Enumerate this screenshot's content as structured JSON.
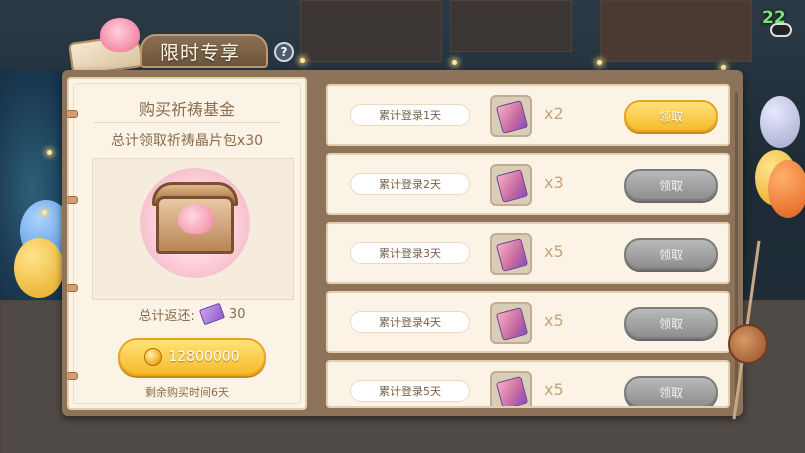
{
  "header": {
    "title": "限时专享",
    "help_label": "?",
    "top_counter": "22"
  },
  "fund": {
    "title": "购买祈祷基金",
    "subtitle": "总计领取祈祷晶片包x30",
    "total_return_label": "总计返还:",
    "total_return_value": "30",
    "price": "12800000",
    "remaining": "剩余购买时间6天"
  },
  "rewards": [
    {
      "day": "累计登录1天",
      "qty": "x2",
      "claim": "领取",
      "state": "active"
    },
    {
      "day": "累计登录2天",
      "qty": "x3",
      "claim": "领取",
      "state": "locked"
    },
    {
      "day": "累计登录3天",
      "qty": "x5",
      "claim": "领取",
      "state": "locked"
    },
    {
      "day": "累计登录4天",
      "qty": "x5",
      "claim": "领取",
      "state": "locked"
    },
    {
      "day": "累计登录5天",
      "qty": "x5",
      "claim": "领取",
      "state": "locked"
    }
  ],
  "icons": {
    "help": "question-icon",
    "coin": "coin-icon",
    "reward_item": "prayer-card-icon",
    "chest": "treasure-chest-icon"
  },
  "colors": {
    "active_button": "#f7bb2c",
    "disabled_button": "#8e8e8e",
    "text_brown": "#8a6b4e"
  }
}
